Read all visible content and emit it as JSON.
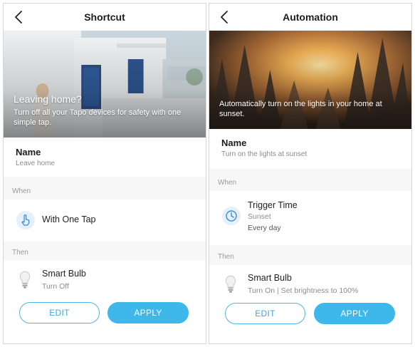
{
  "left": {
    "title": "Shortcut",
    "hero": {
      "title": "Leaving home?",
      "desc": "Turn off all your Tapo devices for safety with one simple tap."
    },
    "name": {
      "label": "Name",
      "value": "Leave home"
    },
    "when": {
      "label": "When",
      "title": "With One Tap",
      "icon": "tap-icon"
    },
    "then": {
      "label": "Then",
      "device": "Smart Bulb",
      "action": "Turn Off",
      "icon": "bulb-icon"
    },
    "buttons": {
      "edit": "EDIT",
      "apply": "APPLY"
    }
  },
  "right": {
    "title": "Automation",
    "hero": {
      "desc": "Automatically turn on the lights in your home at sunset."
    },
    "name": {
      "label": "Name",
      "value": "Turn on the lights at sunset"
    },
    "when": {
      "label": "When",
      "title": "Trigger Time",
      "sub1": "Sunset",
      "sub2": "Every day",
      "icon": "clock-icon"
    },
    "then": {
      "label": "Then",
      "device": "Smart Bulb",
      "action": "Turn On | Set brightness to 100%",
      "icon": "bulb-icon"
    },
    "buttons": {
      "edit": "EDIT",
      "apply": "APPLY"
    }
  },
  "colors": {
    "accent": "#3eb8ea",
    "icon_bg": "#e4f0fa",
    "muted": "#8c8c8c"
  }
}
